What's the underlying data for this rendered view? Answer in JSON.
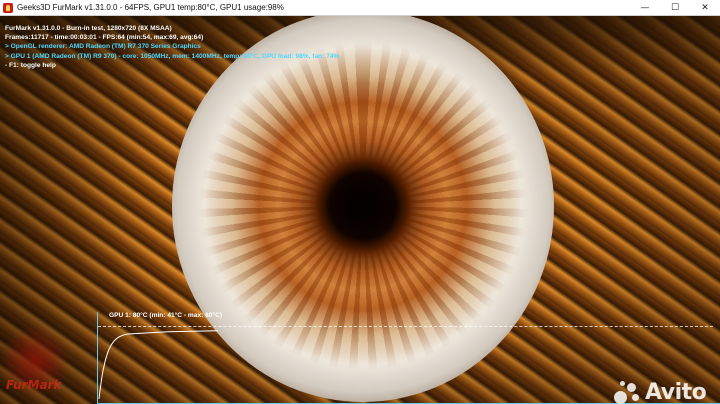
{
  "window": {
    "title": "Geeks3D FurMark v1.31.0.0 - 64FPS, GPU1 temp:80°C, GPU1 usage:98%",
    "minimize_glyph": "—",
    "maximize_glyph": "☐",
    "close_glyph": "✕"
  },
  "osd": {
    "line1": "FurMark v1.31.0.0 - Burn-in test, 1280x720 (8X MSAA)",
    "line2": "Frames:11717 - time:00:03:01 - FPS:64 (min:54, max:69, avg:64)",
    "line3": "> OpenGL renderer: AMD Radeon (TM) R7 370 Series Graphics",
    "line4": "> GPU 1 (AMD Radeon (TM) R9 370) - core: 1050MHz, mem: 1400MHz, temp: 80°C, GPU load: 98%, fan: 74%",
    "line5": "- F1: toggle help"
  },
  "graph": {
    "title": "GPU 1: 80°C (min: 41°C - max: 80°C)",
    "temp_min_c": 41,
    "temp_max_c": 80,
    "temp_current_c": 80,
    "line_color": "#ffffff",
    "axis_color": "#69c9e6"
  },
  "logo": {
    "text": "FurMark",
    "icon": "furmark-logo-icon"
  },
  "watermark": {
    "text": "Avito",
    "icon": "avito-dots-icon"
  },
  "colors": {
    "osd_white": "#ffffff",
    "osd_cyan": "#4fd8ff",
    "accent_red": "#c81e1e"
  }
}
